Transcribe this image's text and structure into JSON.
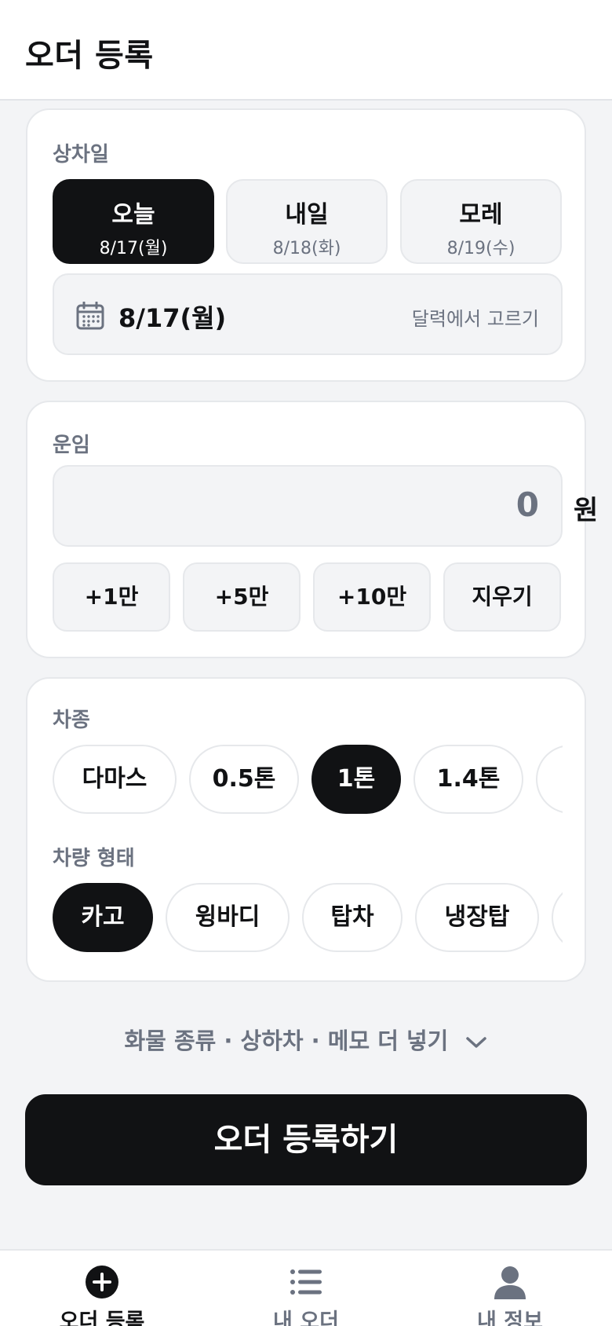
{
  "header": {
    "title": "오더 등록"
  },
  "pickup": {
    "label": "상차일",
    "days": [
      {
        "name": "오늘",
        "date": "8/17(월)",
        "selected": true
      },
      {
        "name": "내일",
        "date": "8/18(화)",
        "selected": false
      },
      {
        "name": "모레",
        "date": "8/19(수)",
        "selected": false
      }
    ],
    "selected_date": "8/17(월)",
    "calendar_link": "달력에서 고르기"
  },
  "fare": {
    "label": "운임",
    "value": "0",
    "unit": "원",
    "quick_buttons": [
      "+1만",
      "+5만",
      "+10만",
      "지우기"
    ]
  },
  "vehicle": {
    "type_label": "차종",
    "types": [
      "다마스",
      "0.5톤",
      "1톤",
      "1.4톤"
    ],
    "type_selected": "1톤",
    "body_label": "차량 형태",
    "bodies": [
      "카고",
      "윙바디",
      "탑차",
      "냉장탑"
    ],
    "body_selected": "카고"
  },
  "more_options": {
    "label": "화물 종류 · 상하차 · 메모 더 넣기",
    "icon": "chevron-down-icon"
  },
  "submit": {
    "label": "오더 등록하기"
  },
  "tabbar": {
    "items": [
      {
        "label": "오더 등록",
        "icon": "plus-circle-icon",
        "active": true
      },
      {
        "label": "내 오더",
        "icon": "list-icon",
        "active": false
      },
      {
        "label": "내 정보",
        "icon": "user-icon",
        "active": false
      }
    ]
  },
  "colors": {
    "primary": "#111214",
    "muted": "#6b7280",
    "surface": "#f3f4f6",
    "border": "#e6e8eb"
  }
}
